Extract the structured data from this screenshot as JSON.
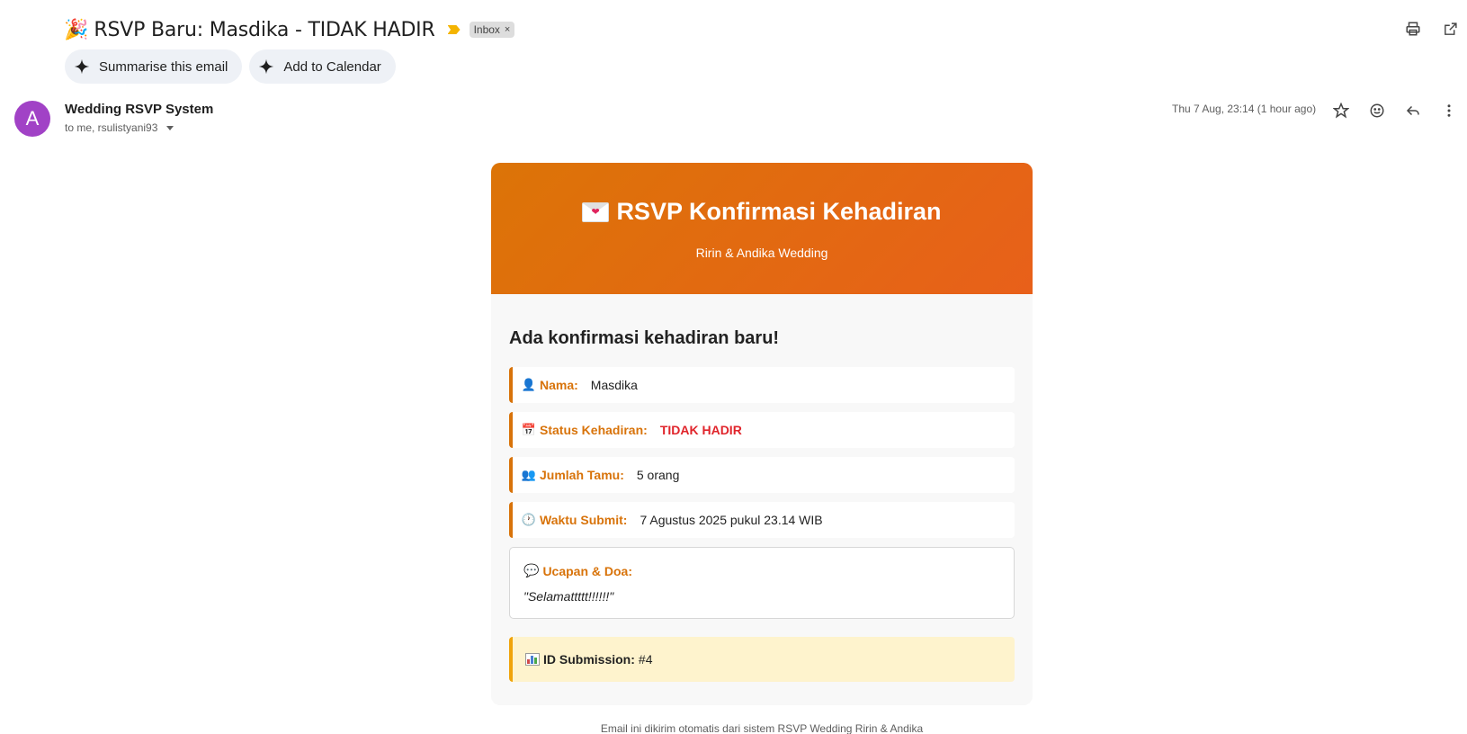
{
  "subject": {
    "emoji": "🎉",
    "text": "RSVP Baru: Masdika - TIDAK HADIR",
    "label": "Inbox",
    "label_close": "×"
  },
  "top_actions": {
    "print_icon": "printer-icon",
    "new_window_icon": "open-in-new-window-icon"
  },
  "pills": [
    {
      "label": "Summarise this email",
      "icon": "sparkle-icon"
    },
    {
      "label": "Add to Calendar",
      "icon": "sparkle-icon"
    }
  ],
  "sender": {
    "avatar_letter": "A",
    "avatar_color": "#a142c6",
    "name": "Wedding RSVP System",
    "recipients": "to me, rsulistyani93",
    "date": "Thu 7 Aug, 23:14 (1 hour ago)"
  },
  "email": {
    "header_title": "RSVP Konfirmasi Kehadiran",
    "header_subtitle": "Ririn & Andika Wedding",
    "heading": "Ada konfirmasi kehadiran baru!",
    "fields": [
      {
        "icon": "👤",
        "label": "Nama:",
        "value": "Masdika"
      },
      {
        "icon": "📅",
        "label": "Status Kehadiran:",
        "value": "TIDAK HADIR"
      },
      {
        "icon": "👥",
        "label": "Jumlah Tamu:",
        "value": "5 orang"
      },
      {
        "icon": "🕐",
        "label": "Waktu Submit:",
        "value": "7 Agustus 2025 pukul 23.14 WIB"
      }
    ],
    "message_icon": "💬",
    "message_label": "Ucapan & Doa:",
    "message_text": "\"Selamattttt!!!!!!\"",
    "id_label": "ID Submission:",
    "id_value": "#4",
    "footer": "Email ini dikirim otomatis dari sistem RSVP Wedding Ririn & Andika"
  },
  "colors": {
    "accent_orange": "#d8730a",
    "status_red": "#e0242b",
    "header_gradient_start": "#dc7407",
    "header_gradient_end": "#e8601a"
  }
}
